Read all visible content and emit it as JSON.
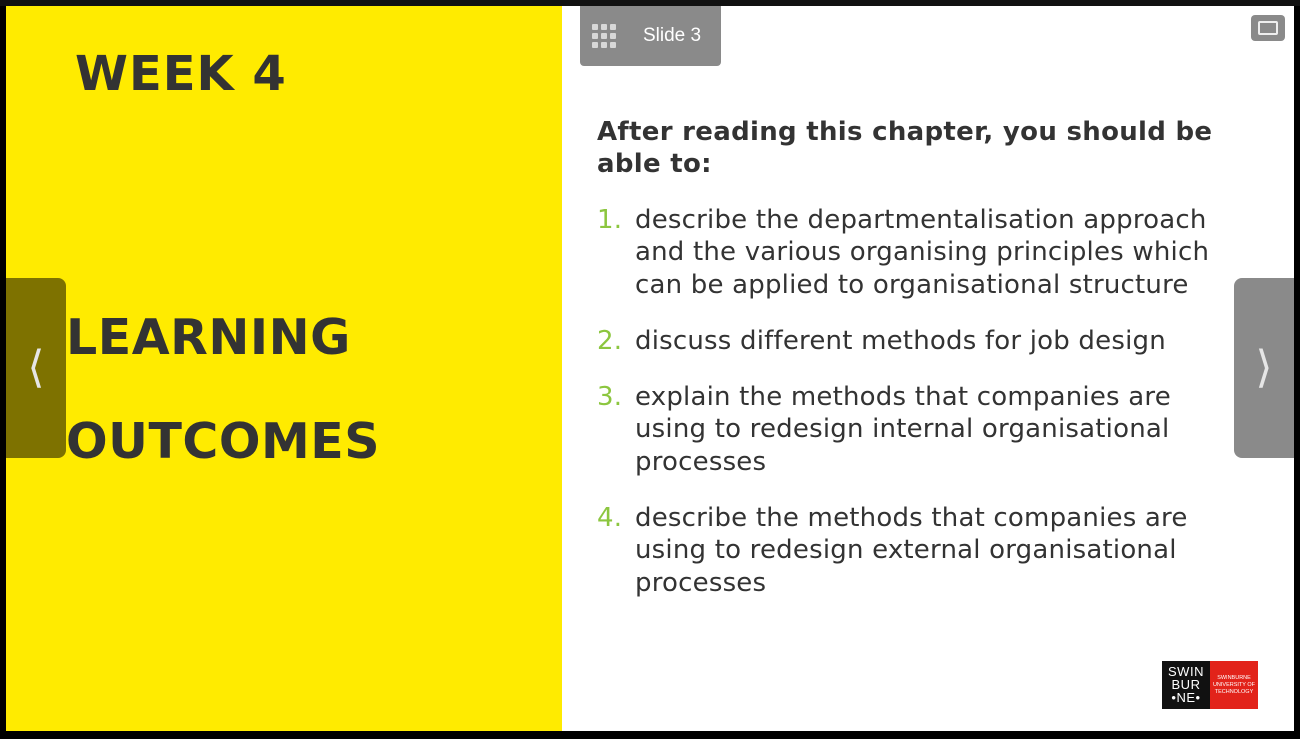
{
  "navigation": {
    "slide_label": "Slide 3",
    "prev_glyph": "⟨",
    "next_glyph": "⟩"
  },
  "left_panel": {
    "week": "WEEK 4",
    "title_line1": "LEARNING",
    "title_line2": "OUTCOMES"
  },
  "content": {
    "intro": "After reading this chapter, you should be able to:",
    "outcomes": [
      {
        "number": "1.",
        "text": "describe the departmentalisation approach and the various organising principles which can be applied to organisational structure"
      },
      {
        "number": "2.",
        "text": "discuss different methods for job design"
      },
      {
        "number": "3.",
        "text": "explain the methods that companies are using to redesign internal organisational processes"
      },
      {
        "number": "4.",
        "text": "describe the methods that companies are using to redesign external organisational processes"
      }
    ]
  },
  "logo": {
    "mark_line1": "SWIN",
    "mark_line2": "BUR",
    "mark_line3": "•NE•",
    "text": "SWINBURNE UNIVERSITY OF TECHNOLOGY"
  },
  "colors": {
    "accent_yellow": "#ffeb00",
    "number_green": "#8cc63f",
    "text_dark": "#333333",
    "logo_red": "#e2231a"
  },
  "icons": {
    "slide_menu": "grid-icon",
    "window": "window-toggle-icon"
  }
}
